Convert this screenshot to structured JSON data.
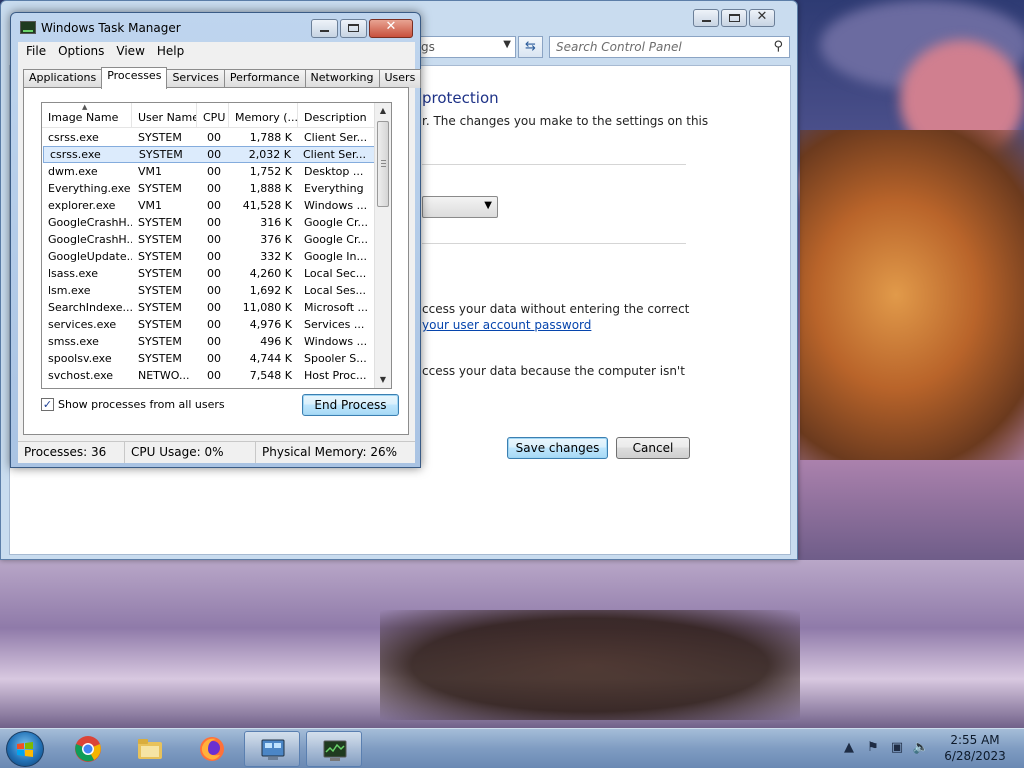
{
  "control_panel": {
    "address_text": "gs",
    "search_placeholder": "Search Control Panel",
    "heading": "protection",
    "description": "r. The changes you make to the settings on this",
    "line1": "ccess your data without entering the correct",
    "link": "your user account password",
    "line2": "ccess your data because the computer isn't",
    "save_label": "Save changes",
    "cancel_label": "Cancel"
  },
  "task_manager": {
    "title": "Windows Task Manager",
    "menu": [
      "File",
      "Options",
      "View",
      "Help"
    ],
    "tabs": [
      "Applications",
      "Processes",
      "Services",
      "Performance",
      "Networking",
      "Users"
    ],
    "active_tab": "Processes",
    "columns": [
      "Image Name",
      "User Name",
      "CPU",
      "Memory (...",
      "Description"
    ],
    "processes": [
      {
        "name": "csrss.exe",
        "user": "SYSTEM",
        "cpu": "00",
        "mem": "1,788 K",
        "desc": "Client Ser..."
      },
      {
        "name": "csrss.exe",
        "user": "SYSTEM",
        "cpu": "00",
        "mem": "2,032 K",
        "desc": "Client Ser..."
      },
      {
        "name": "dwm.exe",
        "user": "VM1",
        "cpu": "00",
        "mem": "1,752 K",
        "desc": "Desktop ..."
      },
      {
        "name": "Everything.exe",
        "user": "SYSTEM",
        "cpu": "00",
        "mem": "1,888 K",
        "desc": "Everything"
      },
      {
        "name": "explorer.exe",
        "user": "VM1",
        "cpu": "00",
        "mem": "41,528 K",
        "desc": "Windows ..."
      },
      {
        "name": "GoogleCrashH...",
        "user": "SYSTEM",
        "cpu": "00",
        "mem": "316 K",
        "desc": "Google Cr..."
      },
      {
        "name": "GoogleCrashH...",
        "user": "SYSTEM",
        "cpu": "00",
        "mem": "376 K",
        "desc": "Google Cr..."
      },
      {
        "name": "GoogleUpdate....",
        "user": "SYSTEM",
        "cpu": "00",
        "mem": "332 K",
        "desc": "Google In..."
      },
      {
        "name": "lsass.exe",
        "user": "SYSTEM",
        "cpu": "00",
        "mem": "4,260 K",
        "desc": "Local Sec..."
      },
      {
        "name": "lsm.exe",
        "user": "SYSTEM",
        "cpu": "00",
        "mem": "1,692 K",
        "desc": "Local Ses..."
      },
      {
        "name": "SearchIndexe...",
        "user": "SYSTEM",
        "cpu": "00",
        "mem": "11,080 K",
        "desc": "Microsoft ..."
      },
      {
        "name": "services.exe",
        "user": "SYSTEM",
        "cpu": "00",
        "mem": "4,976 K",
        "desc": "Services ..."
      },
      {
        "name": "smss.exe",
        "user": "SYSTEM",
        "cpu": "00",
        "mem": "496 K",
        "desc": "Windows ..."
      },
      {
        "name": "spoolsv.exe",
        "user": "SYSTEM",
        "cpu": "00",
        "mem": "4,744 K",
        "desc": "Spooler S..."
      },
      {
        "name": "svchost.exe",
        "user": "NETWO...",
        "cpu": "00",
        "mem": "7,548 K",
        "desc": "Host Proc..."
      }
    ],
    "selected_row": 1,
    "show_all_label": "Show processes from all users",
    "show_all_checked": true,
    "end_process_label": "End Process",
    "status": {
      "processes": "Processes: 36",
      "cpu": "CPU Usage: 0%",
      "memory": "Physical Memory: 26%"
    }
  },
  "taskbar": {
    "items": [
      "start-button",
      "chrome-icon",
      "explorer-icon",
      "firefox-icon",
      "control-panel-icon",
      "task-manager-icon"
    ],
    "tray_icons": [
      "show-hidden-icons-arrow",
      "action-center-icon",
      "network-icon",
      "volume-icon"
    ],
    "time": "2:55 AM",
    "date": "6/28/2023"
  }
}
